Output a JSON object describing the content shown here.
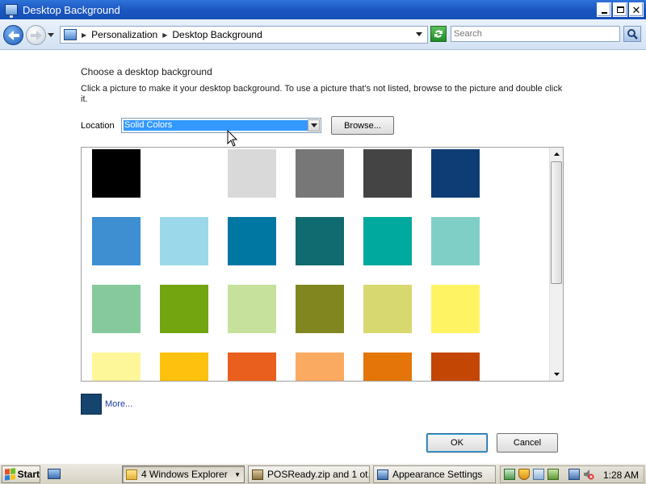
{
  "window": {
    "title": "Desktop Background",
    "minimize_icon": "minimize-icon",
    "restore_icon": "restore-icon",
    "close_icon": "close-icon"
  },
  "navbar": {
    "breadcrumb": [
      "Personalization",
      "Desktop Background"
    ],
    "search_placeholder": "Search"
  },
  "content": {
    "heading": "Choose a desktop background",
    "description": "Click a picture to make it your desktop background. To use a picture that's not listed, browse to the picture and double click it.",
    "location_label": "Location",
    "location_value": "Solid Colors",
    "browse_label": "Browse...",
    "more_label": "More...",
    "more_color": "#15456e",
    "swatches": [
      "#000000",
      "#ffffff",
      "#d9d9d9",
      "#777777",
      "#444444",
      "#0e3d75",
      "#3d8fd1",
      "#9bd8ea",
      "#0076a3",
      "#0f6b6f",
      "#00a99d",
      "#7fcfc7",
      "#86c99c",
      "#73a510",
      "#c6e19c",
      "#82861f",
      "#d8d871",
      "#fef463",
      "#fef799",
      "#fec10d",
      "#e95f1d",
      "#fbab61",
      "#e47508",
      "#c34605"
    ]
  },
  "buttons": {
    "ok": "OK",
    "cancel": "Cancel"
  },
  "taskbar": {
    "start": "Start",
    "tasks": [
      {
        "label": "4 Windows Explorer",
        "active": true
      },
      {
        "label": "POSReady.zip and 1 ot...",
        "active": false
      },
      {
        "label": "Appearance Settings",
        "active": false
      }
    ],
    "clock": "1:28 AM"
  }
}
